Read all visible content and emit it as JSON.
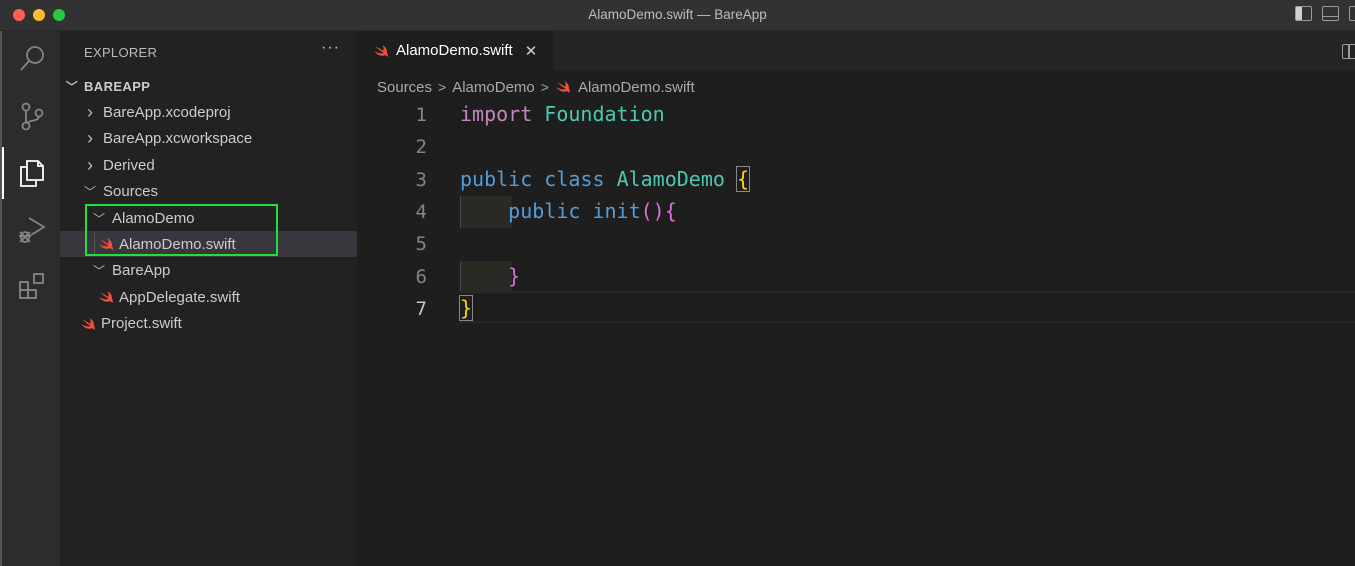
{
  "window": {
    "title": "AlamoDemo.swift — BareApp",
    "controls": [
      "close",
      "minimize",
      "maximize"
    ],
    "layout_icons": [
      "toggle-primary-sidebar-icon",
      "toggle-panel-icon",
      "toggle-secondary-sidebar-icon"
    ]
  },
  "activity_bar": {
    "items": [
      {
        "name": "search",
        "icon": "search-icon",
        "active": false
      },
      {
        "name": "source-control",
        "icon": "source-control-icon",
        "active": false
      },
      {
        "name": "explorer",
        "icon": "files-icon",
        "active": true
      },
      {
        "name": "run-and-debug",
        "icon": "run-debug-icon",
        "active": false
      },
      {
        "name": "extensions",
        "icon": "extensions-icon",
        "active": false
      }
    ]
  },
  "sidebar": {
    "title": "EXPLORER",
    "more_label": "···",
    "root": {
      "label": "BAREAPP",
      "expanded": true
    },
    "tree": [
      {
        "label": "BareApp.xcodeproj",
        "type": "folder",
        "expanded": false,
        "depth": 1
      },
      {
        "label": "BareApp.xcworkspace",
        "type": "folder",
        "expanded": false,
        "depth": 1
      },
      {
        "label": "Derived",
        "type": "folder",
        "expanded": false,
        "depth": 1
      },
      {
        "label": "Sources",
        "type": "folder",
        "expanded": true,
        "depth": 1
      },
      {
        "label": "AlamoDemo",
        "type": "folder",
        "expanded": true,
        "depth": 2
      },
      {
        "label": "AlamoDemo.swift",
        "type": "swift-file",
        "depth": 3,
        "selected": true
      },
      {
        "label": "BareApp",
        "type": "folder",
        "expanded": true,
        "depth": 2
      },
      {
        "label": "AppDelegate.swift",
        "type": "swift-file",
        "depth": 3
      },
      {
        "label": "Project.swift",
        "type": "swift-file",
        "depth": 1
      }
    ]
  },
  "tabs": [
    {
      "label": "AlamoDemo.swift",
      "icon": "swift-icon",
      "active": true,
      "close_label": "✕"
    }
  ],
  "breadcrumb": {
    "items": [
      "Sources",
      "AlamoDemo",
      "AlamoDemo.swift"
    ],
    "separator": ">"
  },
  "editor": {
    "current_line": 7,
    "lines": [
      {
        "number": "1",
        "tokens": [
          {
            "text": "import",
            "cls": "kw-pink"
          },
          {
            "text": " "
          },
          {
            "text": "Foundation",
            "cls": "type-teal"
          }
        ]
      },
      {
        "number": "2",
        "tokens": []
      },
      {
        "number": "3",
        "tokens": [
          {
            "text": "public",
            "cls": "kw-blue"
          },
          {
            "text": " "
          },
          {
            "text": "class",
            "cls": "kw-blue"
          },
          {
            "text": " "
          },
          {
            "text": "AlamoDemo",
            "cls": "type-teal"
          },
          {
            "text": " "
          },
          {
            "text": "{",
            "cls": "bracket-yellow bracket-box"
          }
        ]
      },
      {
        "number": "4",
        "tokens": [
          {
            "text": "    "
          },
          {
            "text": "public",
            "cls": "kw-blue"
          },
          {
            "text": " "
          },
          {
            "text": "init",
            "cls": "kw-blue"
          },
          {
            "text": "()",
            "cls": "bracket-pink"
          },
          {
            "text": "{",
            "cls": "bracket-pink"
          }
        ]
      },
      {
        "number": "5",
        "tokens": []
      },
      {
        "number": "6",
        "tokens": [
          {
            "text": "    "
          },
          {
            "text": "}",
            "cls": "bracket-pink"
          }
        ]
      },
      {
        "number": "7",
        "tokens": [
          {
            "text": "}",
            "cls": "bracket-yellow bracket-box"
          }
        ]
      }
    ]
  },
  "colors": {
    "swift_orange": "#f05138",
    "highlight_box": "#22e03a",
    "keyword_pink": "#c586c0",
    "keyword_blue": "#569cd6",
    "type_teal": "#4ec9b0",
    "bracket_yellow": "#ffd700"
  }
}
